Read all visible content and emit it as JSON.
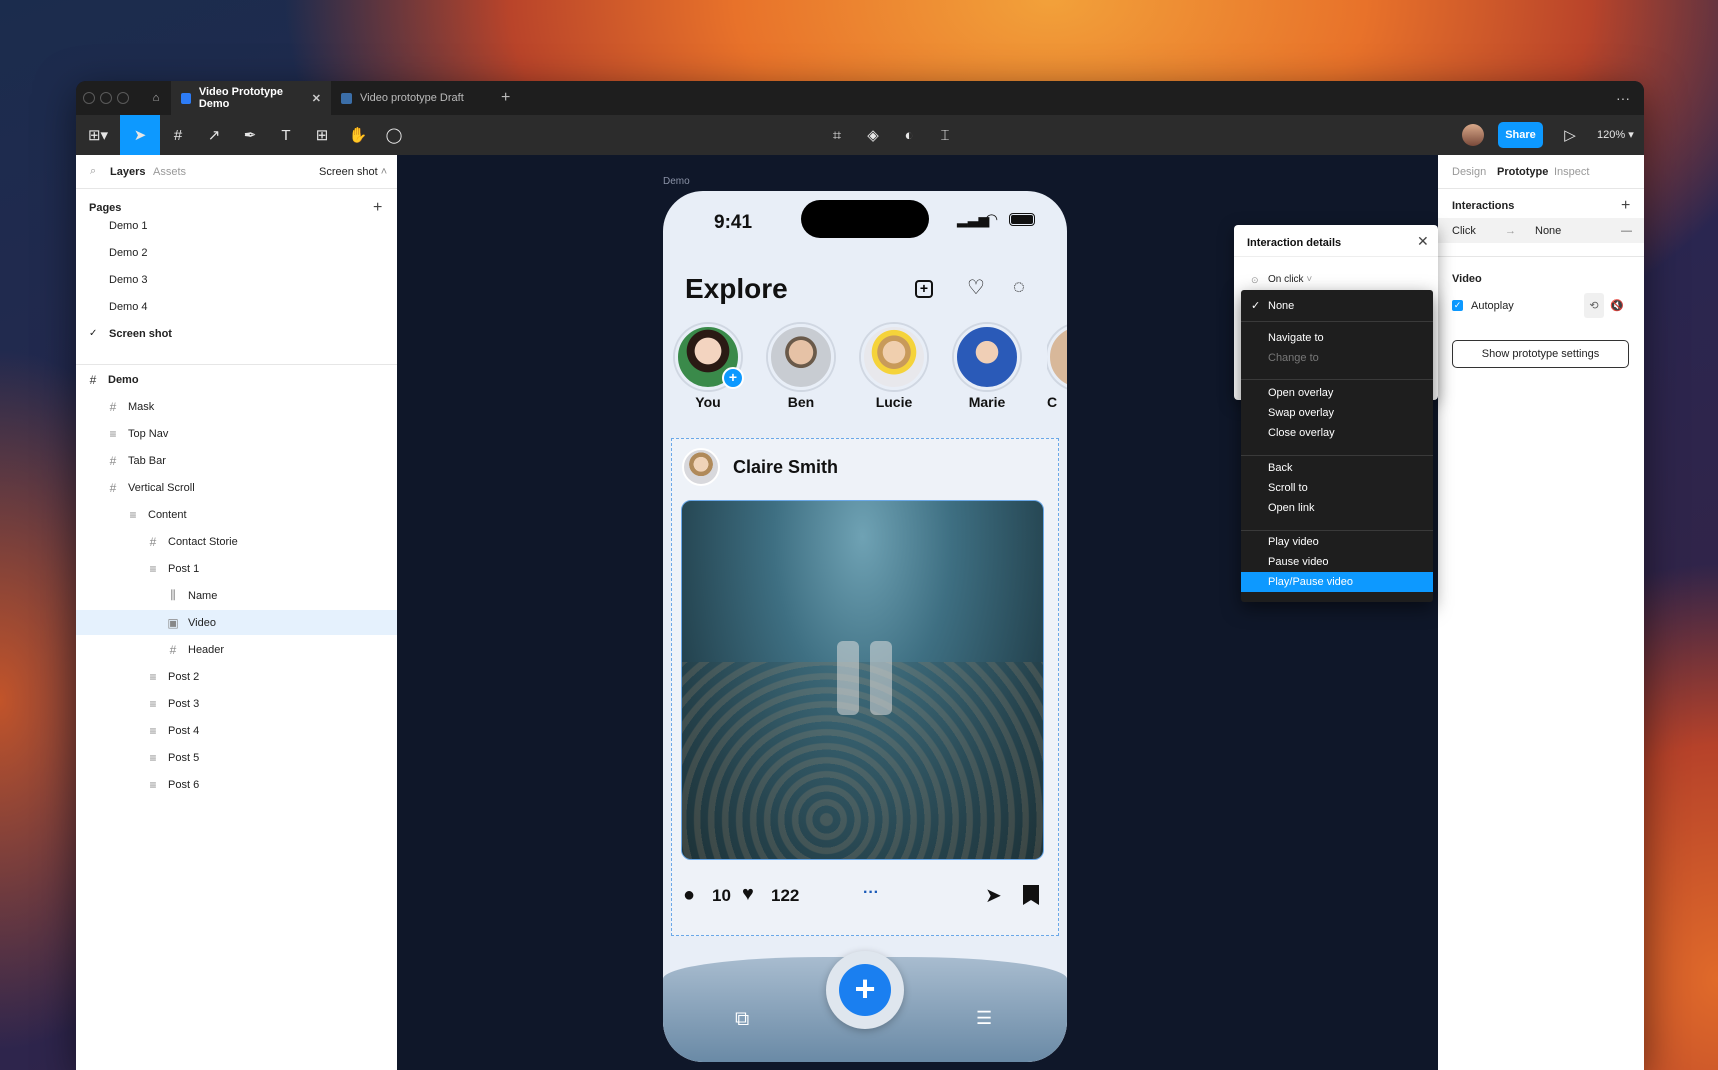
{
  "tabs": [
    {
      "label": "Video Prototype Demo"
    },
    {
      "label": "Video prototype Draft"
    }
  ],
  "toolbar": {
    "share_label": "Share",
    "zoom": "120%"
  },
  "left": {
    "layers_tab": "Layers",
    "assets_tab": "Assets",
    "page_select": "Screen shot",
    "pages_title": "Pages",
    "pages": [
      {
        "label": "Demo 1"
      },
      {
        "label": "Demo 2"
      },
      {
        "label": "Demo 3"
      },
      {
        "label": "Demo 4"
      },
      {
        "label": "Screen shot"
      }
    ],
    "layers": [
      {
        "label": "Demo"
      },
      {
        "label": "Mask"
      },
      {
        "label": "Top Nav"
      },
      {
        "label": "Tab Bar"
      },
      {
        "label": "Vertical Scroll"
      },
      {
        "label": "Content"
      },
      {
        "label": "Contact Storie"
      },
      {
        "label": "Post 1"
      },
      {
        "label": "Name"
      },
      {
        "label": "Video"
      },
      {
        "label": "Header"
      },
      {
        "label": "Post 2"
      },
      {
        "label": "Post 3"
      },
      {
        "label": "Post 4"
      },
      {
        "label": "Post 5"
      },
      {
        "label": "Post 6"
      }
    ]
  },
  "canvas": {
    "frame_label": "Demo"
  },
  "phone": {
    "time": "9:41",
    "title": "Explore",
    "stories": [
      {
        "name": "You"
      },
      {
        "name": "Ben"
      },
      {
        "name": "Lucie"
      },
      {
        "name": "Marie"
      },
      {
        "name": "C"
      }
    ],
    "post": {
      "author": "Claire Smith",
      "comments": "10",
      "likes": "122"
    }
  },
  "interaction": {
    "title": "Interaction details",
    "trigger": "On click",
    "menu": [
      {
        "label": "None"
      },
      {
        "label": "Navigate to"
      },
      {
        "label": "Change to"
      },
      {
        "label": "Open overlay"
      },
      {
        "label": "Swap overlay"
      },
      {
        "label": "Close overlay"
      },
      {
        "label": "Back"
      },
      {
        "label": "Scroll to"
      },
      {
        "label": "Open link"
      },
      {
        "label": "Play video"
      },
      {
        "label": "Pause video"
      },
      {
        "label": "Play/Pause video"
      }
    ]
  },
  "right": {
    "tabs": [
      {
        "label": "Design"
      },
      {
        "label": "Prototype"
      },
      {
        "label": "Inspect"
      }
    ],
    "interactions_title": "Interactions",
    "trigger": "Click",
    "action": "None",
    "video_title": "Video",
    "autoplay": "Autoplay",
    "settings_button": "Show prototype settings"
  },
  "colors": {
    "accent": "#0d99ff",
    "canvas": "#0f1729"
  }
}
